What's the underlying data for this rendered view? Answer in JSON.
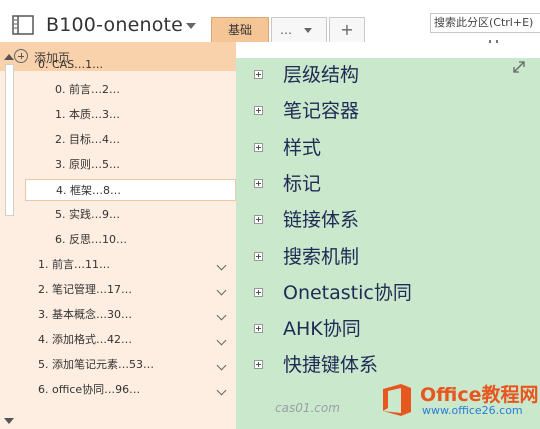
{
  "notebook": {
    "title": "B100-onenote"
  },
  "tabs": {
    "active": "基础",
    "more": "…",
    "add": "+"
  },
  "search": {
    "placeholder": "搜索此分区(Ctrl+E)"
  },
  "page_panel": {
    "add_page_label": "添加页",
    "pages": [
      {
        "label": "0. CAS…1…",
        "level": 0,
        "selected": false,
        "collapsible": false
      },
      {
        "label": "0. 前言…2…",
        "level": 1,
        "selected": false,
        "collapsible": false
      },
      {
        "label": "1. 本质…3…",
        "level": 1,
        "selected": false,
        "collapsible": false
      },
      {
        "label": "2. 目标…4…",
        "level": 1,
        "selected": false,
        "collapsible": false
      },
      {
        "label": "3. 原则…5…",
        "level": 1,
        "selected": false,
        "collapsible": false
      },
      {
        "label": "4. 框架…8…",
        "level": 1,
        "selected": true,
        "collapsible": false
      },
      {
        "label": "5. 实践…9…",
        "level": 1,
        "selected": false,
        "collapsible": false
      },
      {
        "label": "6. 反思…10…",
        "level": 1,
        "selected": false,
        "collapsible": false
      },
      {
        "label": "1. 前言…11…",
        "level": 0,
        "selected": false,
        "collapsible": true
      },
      {
        "label": "2. 笔记管理…17…",
        "level": 0,
        "selected": false,
        "collapsible": true
      },
      {
        "label": "3. 基本概念…30…",
        "level": 0,
        "selected": false,
        "collapsible": true
      },
      {
        "label": "4. 添加格式…42…",
        "level": 0,
        "selected": false,
        "collapsible": true
      },
      {
        "label": "5. 添加笔记元素…53…",
        "level": 0,
        "selected": false,
        "collapsible": true
      },
      {
        "label": "6. office协同…96…",
        "level": 0,
        "selected": false,
        "collapsible": true
      }
    ]
  },
  "content": {
    "items": [
      "层级结构",
      "笔记容器",
      "样式",
      "标记",
      "链接体系",
      "搜索机制",
      "Onetastic协同",
      "AHK协同",
      "快捷键体系"
    ]
  },
  "watermark": {
    "site": "cas01.com",
    "logo_title": "Office教程网",
    "logo_url": "www.office26.com"
  },
  "colors": {
    "accent_tab": "#f6c596",
    "page_panel_bg": "#fdeee1",
    "add_page_bar": "#f9d1aa",
    "content_bg": "#c9e8cc",
    "text_dark": "#1f2a55",
    "logo_orange": "#e8561f"
  },
  "icons": {
    "notebook": "notebook-icon",
    "add_page": "plus-circle-icon",
    "expand": "expand-diagonal-icon",
    "outline_bullet": "plus-box-icon",
    "collapse": "chevron-down-icon"
  }
}
